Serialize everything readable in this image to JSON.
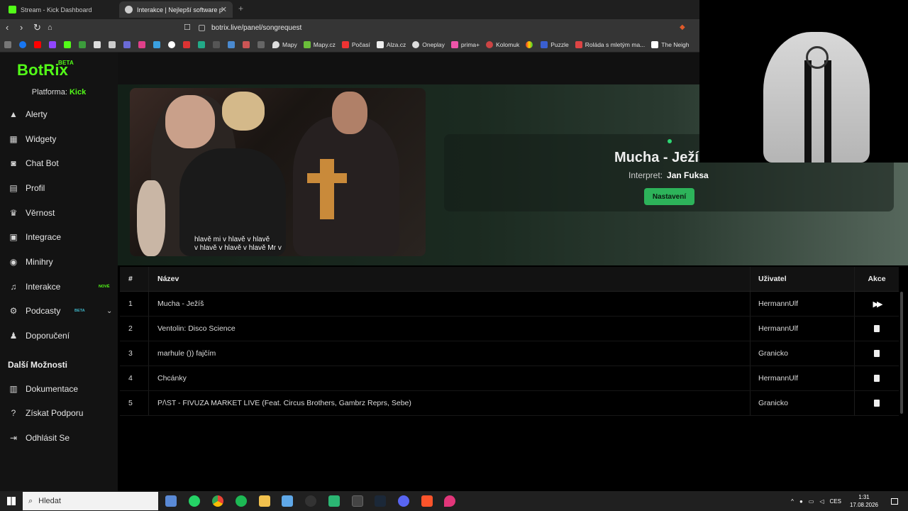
{
  "browser": {
    "tabs": [
      {
        "title": "Stream - Kick Dashboard"
      },
      {
        "title": "Interakce | Nejlepší software p"
      }
    ],
    "url": "botrix.live/panel/songrequest",
    "bookmarks": [
      "Mapy",
      "Mapy.cz",
      "Počasí",
      "Alza.cz",
      "Oneplay",
      "prima+",
      "Kolomuk",
      "Puzzle",
      "Roláda s mletým ma...",
      "The Neigh"
    ]
  },
  "sidebar": {
    "logo": "BotRix",
    "logo_badge": "BETA",
    "platform_label": "Platforma:",
    "platform_value": "Kick",
    "items": [
      {
        "label": "Alerty",
        "icon": "warning-icon"
      },
      {
        "label": "Widgety",
        "icon": "grid-icon"
      },
      {
        "label": "Chat Bot",
        "icon": "robot-icon"
      },
      {
        "label": "Profil",
        "icon": "id-card-icon"
      },
      {
        "label": "Věrnost",
        "icon": "trophy-icon"
      },
      {
        "label": "Integrace",
        "icon": "integration-icon"
      },
      {
        "label": "Minihry",
        "icon": "gamepad-icon"
      },
      {
        "label": "Interakce",
        "icon": "music-icon",
        "badge": "NOVÉ"
      },
      {
        "label": "Podcasty",
        "icon": "podcast-icon",
        "badge": "BETA"
      },
      {
        "label": "Doporučení",
        "icon": "users-icon"
      }
    ],
    "section_title": "Další Možnosti",
    "extra_items": [
      {
        "label": "Dokumentace",
        "icon": "book-icon"
      },
      {
        "label": "Získat Podporu",
        "icon": "question-icon"
      },
      {
        "label": "Odhlásit Se",
        "icon": "logout-icon"
      }
    ]
  },
  "player": {
    "subtitle_line1": "hlavě mi v hlavě v hlavě",
    "subtitle_line2": "v hlavě v hlavě v hlavě Mr v",
    "now_playing_title": "Mucha - Ježíš",
    "artist_label": "Interpret:",
    "artist": "Jan Fuksa",
    "settings_button": "Nastavení"
  },
  "queue": {
    "columns": [
      "#",
      "Název",
      "Uživatel",
      "Akce"
    ],
    "rows": [
      {
        "num": "1",
        "title": "Mucha - Ježíš",
        "user": "HermannUlf",
        "action": "skip"
      },
      {
        "num": "2",
        "title": "Ventolin: Disco Science",
        "user": "HermannUlf",
        "action": "delete"
      },
      {
        "num": "3",
        "title": "marhule ()) fajčím",
        "user": "Granicko",
        "action": "delete"
      },
      {
        "num": "4",
        "title": "Chcánky",
        "user": "HermannUlf",
        "action": "delete"
      },
      {
        "num": "5",
        "title": "P/\\ST - FIVUZA MARKET LIVE (Feat. Circus Brothers, Gambrz Reprs, Sebe)",
        "user": "Granicko",
        "action": "delete"
      }
    ]
  },
  "taskbar": {
    "search_placeholder": "Hledat",
    "language": "CES",
    "time": "1:31",
    "date": "17.08.2026"
  },
  "colors": {
    "brand_green": "#53fc18",
    "button_green": "#2db35a"
  }
}
